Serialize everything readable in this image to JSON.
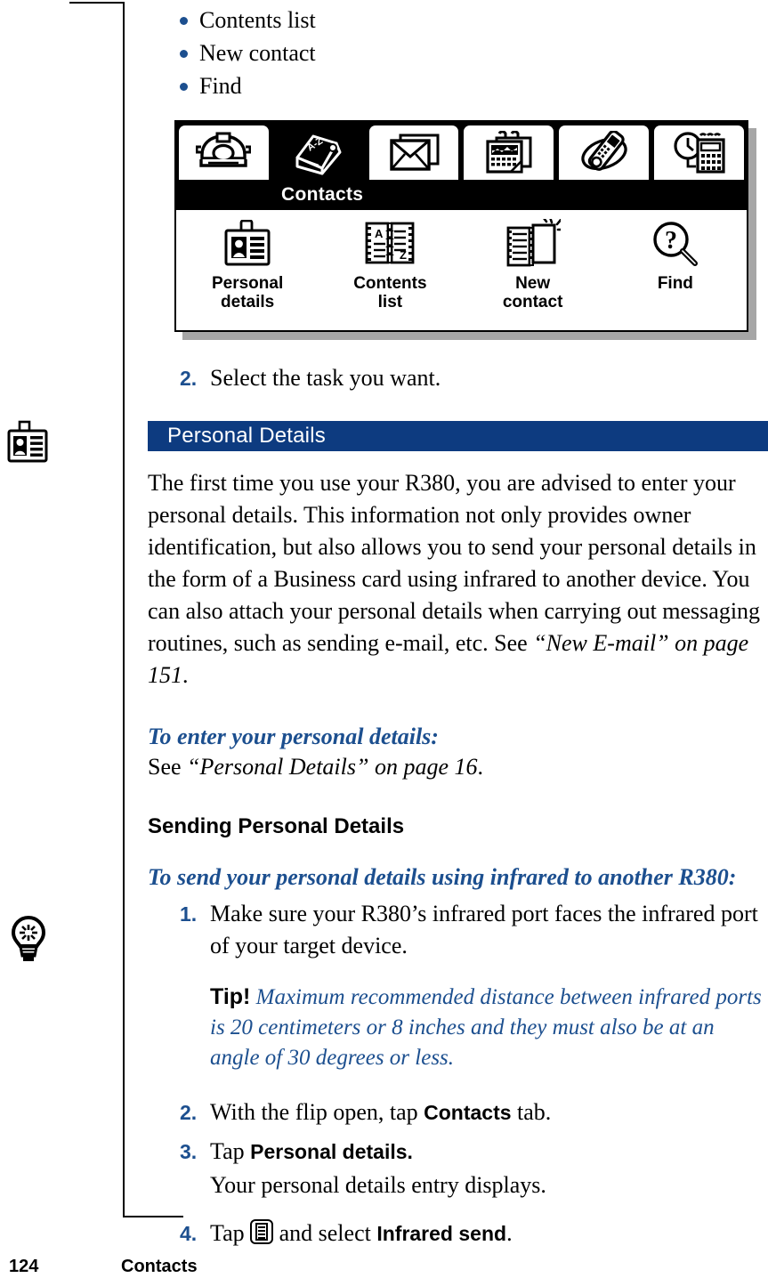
{
  "page": {
    "number": "124",
    "chapter": "Contacts"
  },
  "bullets": [
    {
      "label": "Contents list"
    },
    {
      "label": "New contact"
    },
    {
      "label": "Find"
    }
  ],
  "device": {
    "title": "Contacts",
    "tabs": [
      {
        "icon": "telephone-icon",
        "selected": false
      },
      {
        "icon": "contacts-book-icon",
        "selected": true
      },
      {
        "icon": "envelope-messaging-icon",
        "selected": false
      },
      {
        "icon": "calendar-icon",
        "selected": false
      },
      {
        "icon": "wap-browser-icon",
        "selected": false
      },
      {
        "icon": "clock-calculator-extras-icon",
        "selected": false
      }
    ],
    "apps": [
      {
        "icon": "id-card-icon",
        "label_line1": "Personal",
        "label_line2": "details"
      },
      {
        "icon": "a-z-book-icon",
        "label_line1": "Contents",
        "label_line2": "list"
      },
      {
        "icon": "new-contact-book-icon",
        "label_line1": "New",
        "label_line2": "contact"
      },
      {
        "icon": "magnifier-question-icon",
        "label_line1": "Find",
        "label_line2": ""
      }
    ]
  },
  "step_select_task": {
    "num": "2.",
    "text": "Select the task you want."
  },
  "section": {
    "title": "Personal Details",
    "bar_color": "#0d3b80",
    "paragraph_plain_1": "The first time you use your R380, you are advised to enter your personal details. This information not only provides owner identification, but also allows you to send your personal details in the form of a Business card using infrared to another device. You can also attach your personal details when carrying out messaging routines, such as sending e-mail, etc. See ",
    "paragraph_italic_ref": "“New E-mail” on page 151",
    "paragraph_tail": "."
  },
  "enter_details": {
    "heading": "To enter your personal details:",
    "see_prefix": "See ",
    "see_italic": "“Personal Details” on page 16",
    "see_tail": "."
  },
  "sending": {
    "subhead": "Sending Personal Details",
    "heading": "To send your personal details using infrared to another R380:",
    "steps": [
      {
        "num": "1.",
        "text": "Make sure your R380’s infrared port faces the infrared port of your target device."
      },
      {
        "num": "2.",
        "pre": "With the flip open, tap ",
        "bold": "Contacts",
        "post": " tab."
      },
      {
        "num": "3.",
        "pre": "Tap ",
        "bold": "Personal details.",
        "post": "",
        "sub": "Your personal details entry displays."
      },
      {
        "num": "4.",
        "pre": "Tap ",
        "icon": "menu-list-icon",
        "mid": " and select ",
        "bold": "Infrared send",
        "post": "."
      }
    ],
    "tip": {
      "word": "Tip!",
      "text": " Maximum recommended distance between infrared ports is 20 centimeters or 8 inches and they must also be at an angle of 30 degrees or less."
    }
  },
  "margin_icons": [
    {
      "name": "id-card-icon"
    },
    {
      "name": "lightbulb-tip-icon"
    }
  ],
  "colors": {
    "accent_blue": "#1c4f8f",
    "header_navy": "#0d3b80",
    "shadow_grey": "#a6a6a6"
  }
}
